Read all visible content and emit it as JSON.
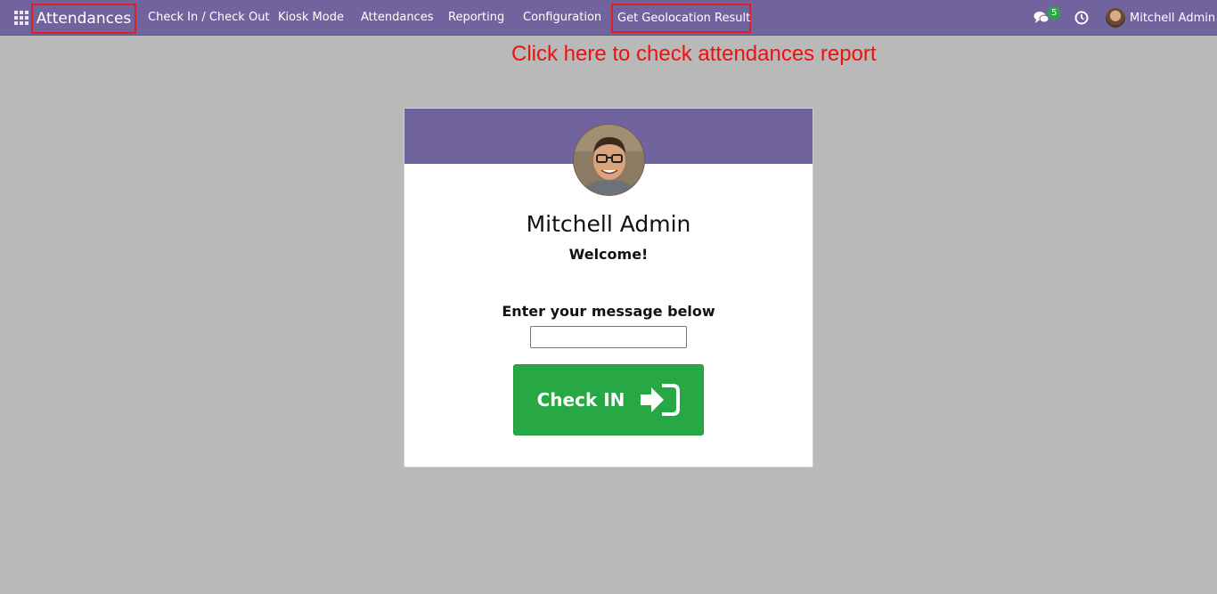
{
  "navbar": {
    "brand": "Attendances",
    "menu": [
      {
        "label": "Check In / Check Out"
      },
      {
        "label": "Kiosk Mode"
      },
      {
        "label": "Attendances"
      },
      {
        "label": "Reporting"
      },
      {
        "label": "Configuration"
      },
      {
        "label": "Get Geolocation Result"
      }
    ],
    "chat_badge": "5",
    "user_name": "Mitchell Admin"
  },
  "annotation": "Click here to check attendances report",
  "card": {
    "employee_name": "Mitchell Admin",
    "welcome": "Welcome!",
    "message_label": "Enter your message below",
    "message_value": "",
    "checkin_label": "Check IN"
  },
  "colors": {
    "navbar": "#71639e",
    "background": "#b8b9b8",
    "checkin_button": "#28a745",
    "annotation": "#ef1010"
  },
  "icons": [
    "apps-grid-icon",
    "chat-icon",
    "clock-icon",
    "sign-in-icon"
  ]
}
